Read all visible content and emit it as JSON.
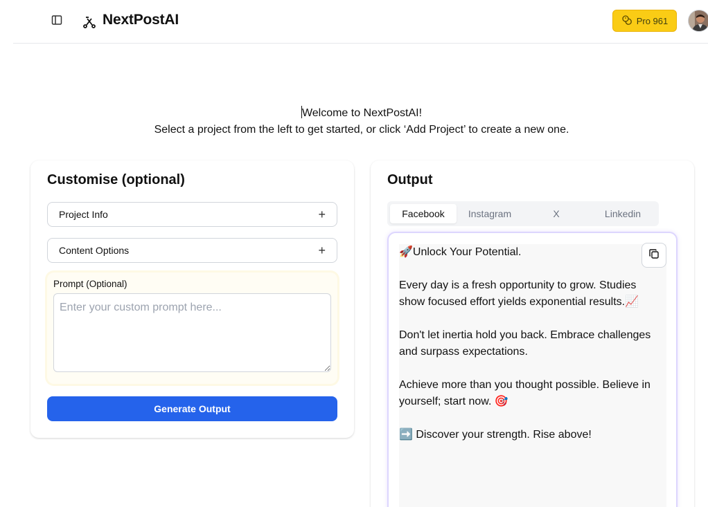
{
  "header": {
    "brand": "NextPostAI",
    "pro_label": "Pro 961"
  },
  "welcome": {
    "line1": "Welcome to NextPostAI!",
    "line2": "Select a project from the left to get started, or click ‘Add Project’ to create a new one."
  },
  "customise": {
    "title": "Customise (optional)",
    "accordions": [
      {
        "label": "Project Info"
      },
      {
        "label": "Content Options"
      }
    ],
    "prompt_label": "Prompt (Optional)",
    "prompt_placeholder": "Enter your custom prompt here...",
    "generate_label": "Generate Output"
  },
  "output": {
    "title": "Output",
    "tabs": [
      {
        "label": "Facebook",
        "active": true
      },
      {
        "label": "Instagram",
        "active": false
      },
      {
        "label": "X",
        "active": false
      },
      {
        "label": "Linkedin",
        "active": false
      }
    ],
    "paragraphs": [
      "🚀Unlock Your Potential.",
      "Every day is a fresh opportunity to grow. Studies show focused effort yields exponential results.📈",
      "Don't let inertia hold you back. Embrace challenges and surpass expectations.",
      "Achieve more than you thought possible. Believe in yourself; start now. 🎯",
      "➡️ Discover your strength. Rise above!"
    ]
  },
  "icons": {
    "sidebar_toggle": "sidebar-toggle-icon",
    "logo": "logo-icon",
    "pro": "coins-icon",
    "copy": "copy-icon",
    "plus": "plus-icon"
  },
  "colors": {
    "primary": "#2563eb",
    "pro_bg": "#facc15",
    "output_border": "#ddd6fe"
  }
}
